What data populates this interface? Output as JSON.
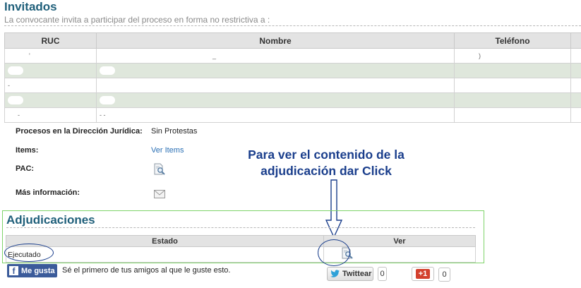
{
  "invitados": {
    "title": "Invitados",
    "subtitle": "La convocante invita a participar del proceso en forma no restrictiva a :",
    "columns": [
      "RUC",
      "Nombre",
      "Teléfono"
    ]
  },
  "details": {
    "procesos_label": "Procesos en la Dirección Jurídica:",
    "procesos_value": "Sin Protestas",
    "items_label": "Items:",
    "items_link": "Ver Items",
    "pac_label": "PAC:",
    "mas_info_label": "Más información:"
  },
  "callout": {
    "line1": "Para ver el contenido de la",
    "line2": "adjudicación dar Click"
  },
  "adjudicaciones": {
    "title": "Adjudicaciones",
    "columns": [
      "Estado",
      "Ver"
    ],
    "rows": [
      {
        "estado": "Ejecutado"
      }
    ]
  },
  "social": {
    "fb_label": "Me gusta",
    "fb_text": "Sé el primero de tus amigos al que le guste esto.",
    "tw_label": "Twittear",
    "tw_count": "0",
    "gp_label": "+1",
    "gp_count": "0"
  },
  "colors": {
    "title": "#1f5f7a",
    "link": "#2a6fb4",
    "callout": "#1a3e8c",
    "highlight_box": "#7ed36a",
    "table_alt_row": "#dfe7dc"
  }
}
